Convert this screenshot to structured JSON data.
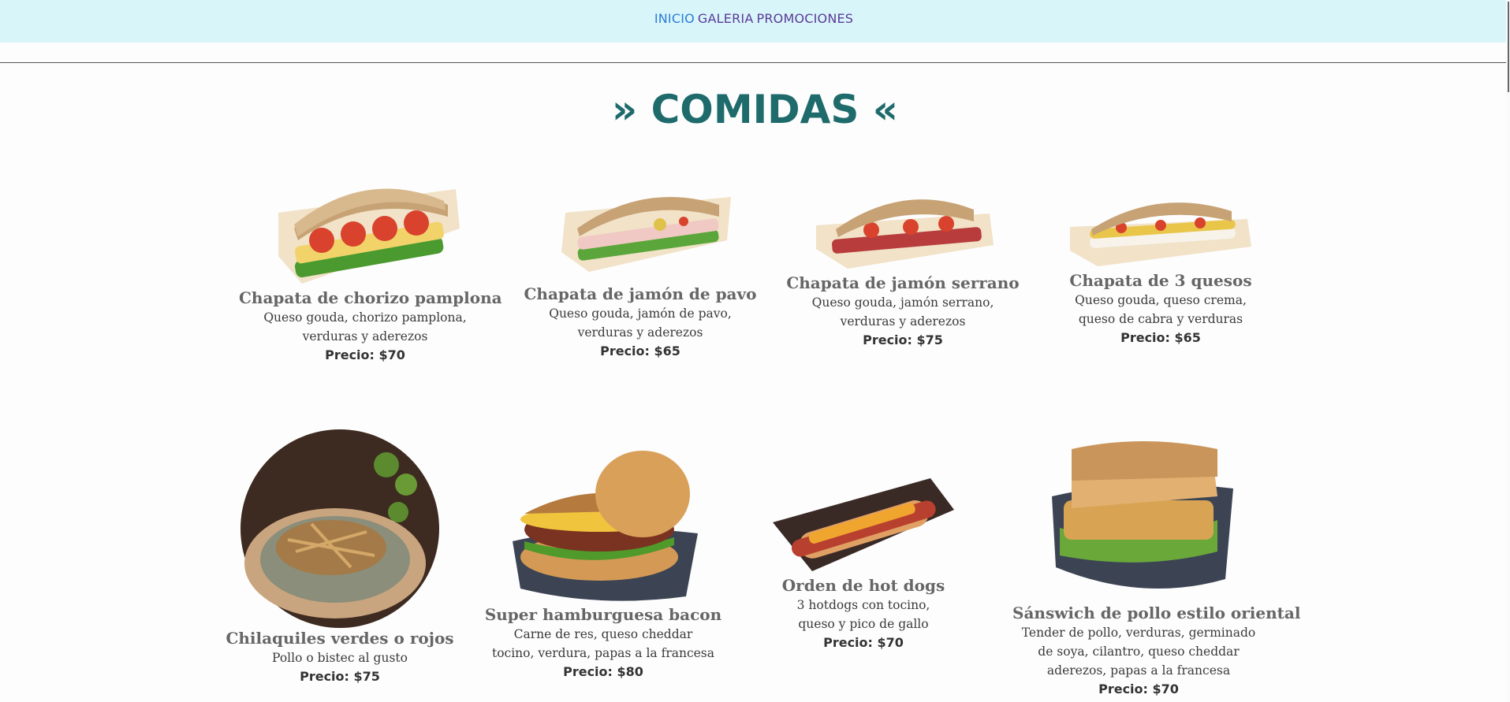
{
  "nav": {
    "inicio": "INICIO",
    "galeria": "GALERIA",
    "promociones": "PROMOCIONES"
  },
  "section_title": "» COMIDAS «",
  "items": [
    {
      "name": "Chapata de chorizo pamplona",
      "desc1": "Queso gouda, chorizo pamplona,",
      "desc2": "verduras y aderezos",
      "desc3": "",
      "price": "Precio: $70"
    },
    {
      "name": "Chapata de jamón de pavo",
      "desc1": "Queso gouda, jamón de pavo,",
      "desc2": "verduras y aderezos",
      "desc3": "",
      "price": "Precio: $65"
    },
    {
      "name": "Chapata de jamón serrano",
      "desc1": "Queso gouda, jamón serrano,",
      "desc2": "verduras y aderezos",
      "desc3": "",
      "price": "Precio: $75"
    },
    {
      "name": "Chapata de 3 quesos",
      "desc1": "Queso gouda, queso crema,",
      "desc2": "queso de cabra y verduras",
      "desc3": "",
      "price": "Precio: $65"
    },
    {
      "name": "Chilaquiles verdes o rojos",
      "desc1": "Pollo o bistec al gusto",
      "desc2": "",
      "desc3": "",
      "price": "Precio: $75"
    },
    {
      "name": "Super hamburguesa bacon",
      "desc1": "Carne de res, queso cheddar",
      "desc2": "tocino, verdura, papas a la francesa",
      "desc3": "",
      "price": "Precio: $80"
    },
    {
      "name": "Orden de hot dogs",
      "desc1": "3 hotdogs con tocino,",
      "desc2": "queso y pico de gallo",
      "desc3": "",
      "price": "Precio: $70"
    },
    {
      "name": "Sánswich de pollo estilo oriental",
      "desc1": "Tender de pollo, verduras, germinado",
      "desc2": "de soya, cilantro, queso cheddar",
      "desc3": "aderezos, papas a la francesa",
      "price": "Precio: $70"
    }
  ]
}
